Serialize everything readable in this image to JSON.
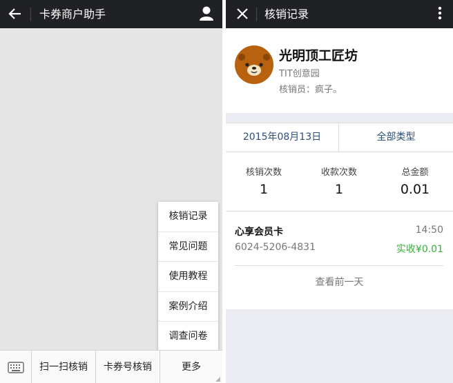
{
  "left": {
    "title": "卡券商户助手",
    "icons": {
      "back": "arrow-left-icon",
      "user": "person-icon",
      "keyboard": "keyboard-icon"
    },
    "menu": [
      "核销记录",
      "常见问题",
      "使用教程",
      "案例介绍",
      "调查问卷"
    ],
    "bottom_bar": {
      "scan_label": "扫一扫核销",
      "code_label": "卡券号核销",
      "more_label": "更多"
    }
  },
  "right": {
    "title": "核销记录",
    "icons": {
      "close": "close-icon",
      "more": "kebab-menu-icon",
      "avatar": "bear-avatar"
    },
    "merchant": {
      "name": "光明顶工匠坊",
      "subtitle": "TIT创意园",
      "staff": "核销员：疯子。"
    },
    "filter": {
      "date": "2015年08月13日",
      "type": "全部类型"
    },
    "stats": [
      {
        "label": "核销次数",
        "value": "1"
      },
      {
        "label": "收款次数",
        "value": "1"
      },
      {
        "label": "总金额",
        "value": "0.01"
      }
    ],
    "record": {
      "title": "心享会员卡",
      "time": "14:50",
      "code": "6024-5206-4831",
      "amount": "实收¥0.01"
    },
    "prev_day_label": "查看前一天"
  },
  "colors": {
    "topbar": "#202124",
    "left_bg": "#e5e5e5",
    "right_bg": "#ebebf2",
    "link_blue": "#2d4d77",
    "amount_green": "#36b03a",
    "avatar_brown": "#b8620f"
  }
}
